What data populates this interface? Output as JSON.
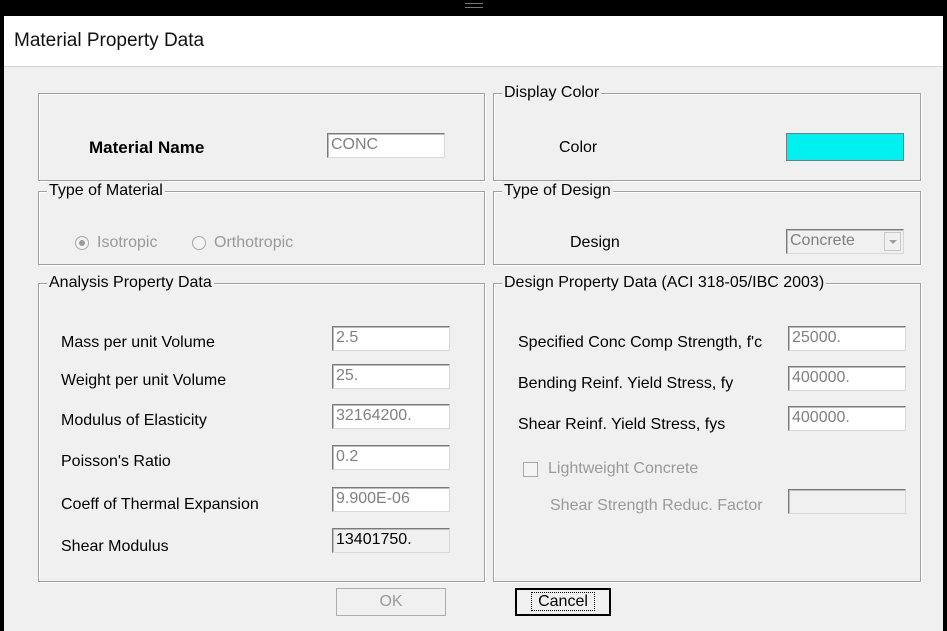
{
  "window": {
    "title": "Material Property Data"
  },
  "material_name": {
    "label": "Material Name",
    "value": "CONC"
  },
  "display_color": {
    "legend": "Display Color",
    "label": "Color",
    "color": "#00f0f0"
  },
  "type_of_material": {
    "legend": "Type of Material",
    "options": [
      {
        "label": "Isotropic",
        "selected": true
      },
      {
        "label": "Orthotropic",
        "selected": false
      }
    ]
  },
  "type_of_design": {
    "legend": "Type of Design",
    "label": "Design",
    "value": "Concrete"
  },
  "analysis": {
    "legend": "Analysis Property Data",
    "rows": [
      {
        "label": "Mass per unit Volume",
        "value": "2.5"
      },
      {
        "label": "Weight per unit Volume",
        "value": "25."
      },
      {
        "label": "Modulus of Elasticity",
        "value": "32164200."
      },
      {
        "label": "Poisson's Ratio",
        "value": "0.2"
      },
      {
        "label": "Coeff of Thermal Expansion",
        "value": "9.900E-06"
      },
      {
        "label": "Shear Modulus",
        "value": "13401750."
      }
    ]
  },
  "design": {
    "legend": "Design Property Data (ACI 318-05/IBC 2003)",
    "rows": [
      {
        "label": "Specified Conc Comp Strength, f'c",
        "value": "25000."
      },
      {
        "label": "Bending Reinf. Yield Stress, fy",
        "value": "400000."
      },
      {
        "label": "Shear Reinf. Yield Stress, fys",
        "value": "400000."
      }
    ],
    "lightweight_label": "Lightweight Concrete",
    "lightweight_checked": false,
    "shear_factor_label": "Shear Strength Reduc. Factor",
    "shear_factor_value": ""
  },
  "buttons": {
    "ok": "OK",
    "cancel": "Cancel"
  }
}
